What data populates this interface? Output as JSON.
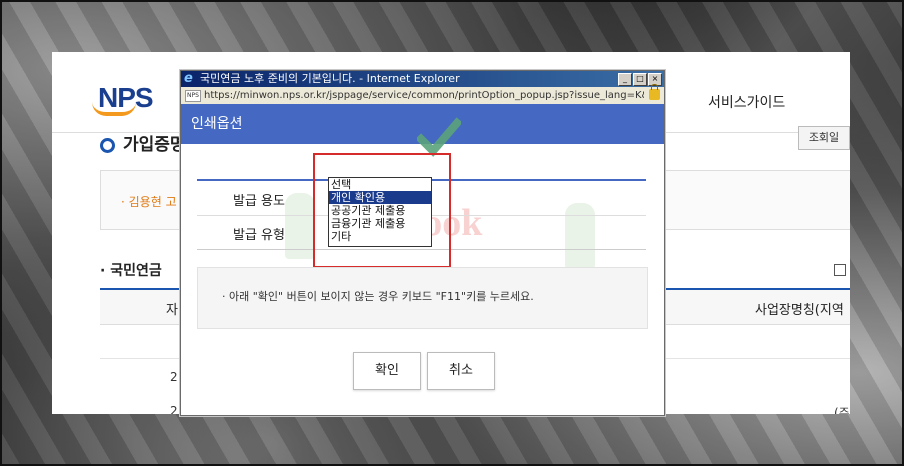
{
  "background_page": {
    "logo_text": "NPS",
    "nav_service_guide": "서비스가이드",
    "section_title": "가입증명",
    "view_button": "조회일",
    "notice_name": "· 김용현 고",
    "subsection_title": "· 국민연금",
    "table_col_left": "자",
    "table_col_right": "사업장명칭(지역",
    "row1_left": "2",
    "row2_left": "2",
    "row2_right": "(주"
  },
  "popup": {
    "window_title": "국민연금 노후 준비의 기본입니다. - Internet Explorer",
    "minimize": "_",
    "maximize": "□",
    "close": "×",
    "favicon": "NPS",
    "url": "https://minwon.nps.or.kr/jsppage/service/common/printOption_popup.jsp?issue_lang=K&",
    "header_title": "인쇄옵션",
    "label_purpose": "발급 용도",
    "label_type": "발급 유형",
    "purpose_options": [
      "선택",
      "개인 확인용",
      "공공기관 제출용",
      "금융기관 제출용",
      "기타"
    ],
    "purpose_selected_index": 1,
    "info_text": "·  아래 \"확인\" 버튼이 보이지 않는 경우 키보드 \"F11\"키를 누르세요.",
    "confirm_button": "확인",
    "cancel_button": "취소",
    "watermark": "ppook"
  },
  "colors": {
    "popup_header": "#4569c2",
    "highlight_border": "#d62b2b",
    "checkmark": "#5aa37a",
    "selected_option": "#1a3a8c"
  }
}
